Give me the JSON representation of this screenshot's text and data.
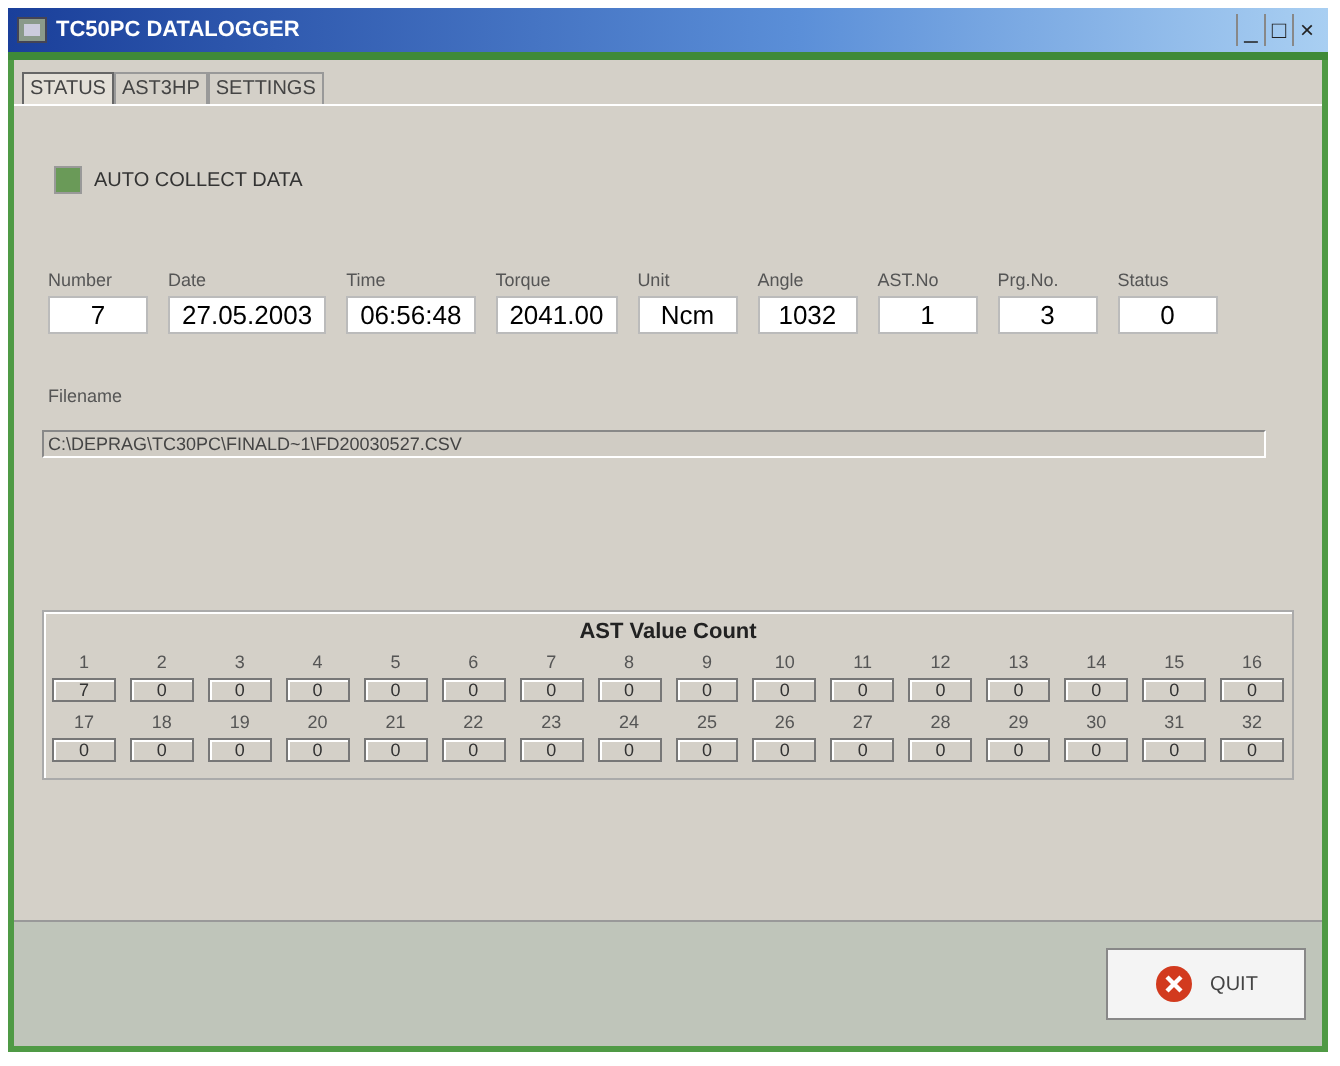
{
  "window": {
    "title": "TC50PC DATALOGGER",
    "controls": [
      "_",
      "□",
      "×"
    ]
  },
  "tabs": [
    {
      "label": "STATUS",
      "selected": true
    },
    {
      "label": "AST3HP",
      "selected": false
    },
    {
      "label": "SETTINGS",
      "selected": false
    }
  ],
  "auto_collect": {
    "label": "AUTO COLLECT DATA",
    "checked": true
  },
  "fields": [
    {
      "label": "Number",
      "value": "7"
    },
    {
      "label": "Date",
      "value": "27.05.2003"
    },
    {
      "label": "Time",
      "value": "06:56:48"
    },
    {
      "label": "Torque",
      "value": "2041.00"
    },
    {
      "label": "Unit",
      "value": "Ncm"
    },
    {
      "label": "Angle",
      "value": "1032"
    },
    {
      "label": "AST.No",
      "value": "1"
    },
    {
      "label": "Prg.No.",
      "value": "3"
    },
    {
      "label": "Status",
      "value": "0"
    }
  ],
  "filename": {
    "label": "Filename",
    "value": "C:\\DEPRAG\\TC30PC\\FINALD~1\\FD20030527.CSV"
  },
  "ast_value_count": {
    "title": "AST Value Count",
    "cells": [
      {
        "label": "1",
        "value": "7"
      },
      {
        "label": "2",
        "value": "0"
      },
      {
        "label": "3",
        "value": "0"
      },
      {
        "label": "4",
        "value": "0"
      },
      {
        "label": "5",
        "value": "0"
      },
      {
        "label": "6",
        "value": "0"
      },
      {
        "label": "7",
        "value": "0"
      },
      {
        "label": "8",
        "value": "0"
      },
      {
        "label": "9",
        "value": "0"
      },
      {
        "label": "10",
        "value": "0"
      },
      {
        "label": "11",
        "value": "0"
      },
      {
        "label": "12",
        "value": "0"
      },
      {
        "label": "13",
        "value": "0"
      },
      {
        "label": "14",
        "value": "0"
      },
      {
        "label": "15",
        "value": "0"
      },
      {
        "label": "16",
        "value": "0"
      },
      {
        "label": "17",
        "value": "0"
      },
      {
        "label": "18",
        "value": "0"
      },
      {
        "label": "19",
        "value": "0"
      },
      {
        "label": "20",
        "value": "0"
      },
      {
        "label": "21",
        "value": "0"
      },
      {
        "label": "22",
        "value": "0"
      },
      {
        "label": "23",
        "value": "0"
      },
      {
        "label": "24",
        "value": "0"
      },
      {
        "label": "25",
        "value": "0"
      },
      {
        "label": "26",
        "value": "0"
      },
      {
        "label": "27",
        "value": "0"
      },
      {
        "label": "28",
        "value": "0"
      },
      {
        "label": "29",
        "value": "0"
      },
      {
        "label": "30",
        "value": "0"
      },
      {
        "label": "31",
        "value": "0"
      },
      {
        "label": "32",
        "value": "0"
      }
    ]
  },
  "buttons": [
    {
      "label": "QUIT"
    }
  ]
}
